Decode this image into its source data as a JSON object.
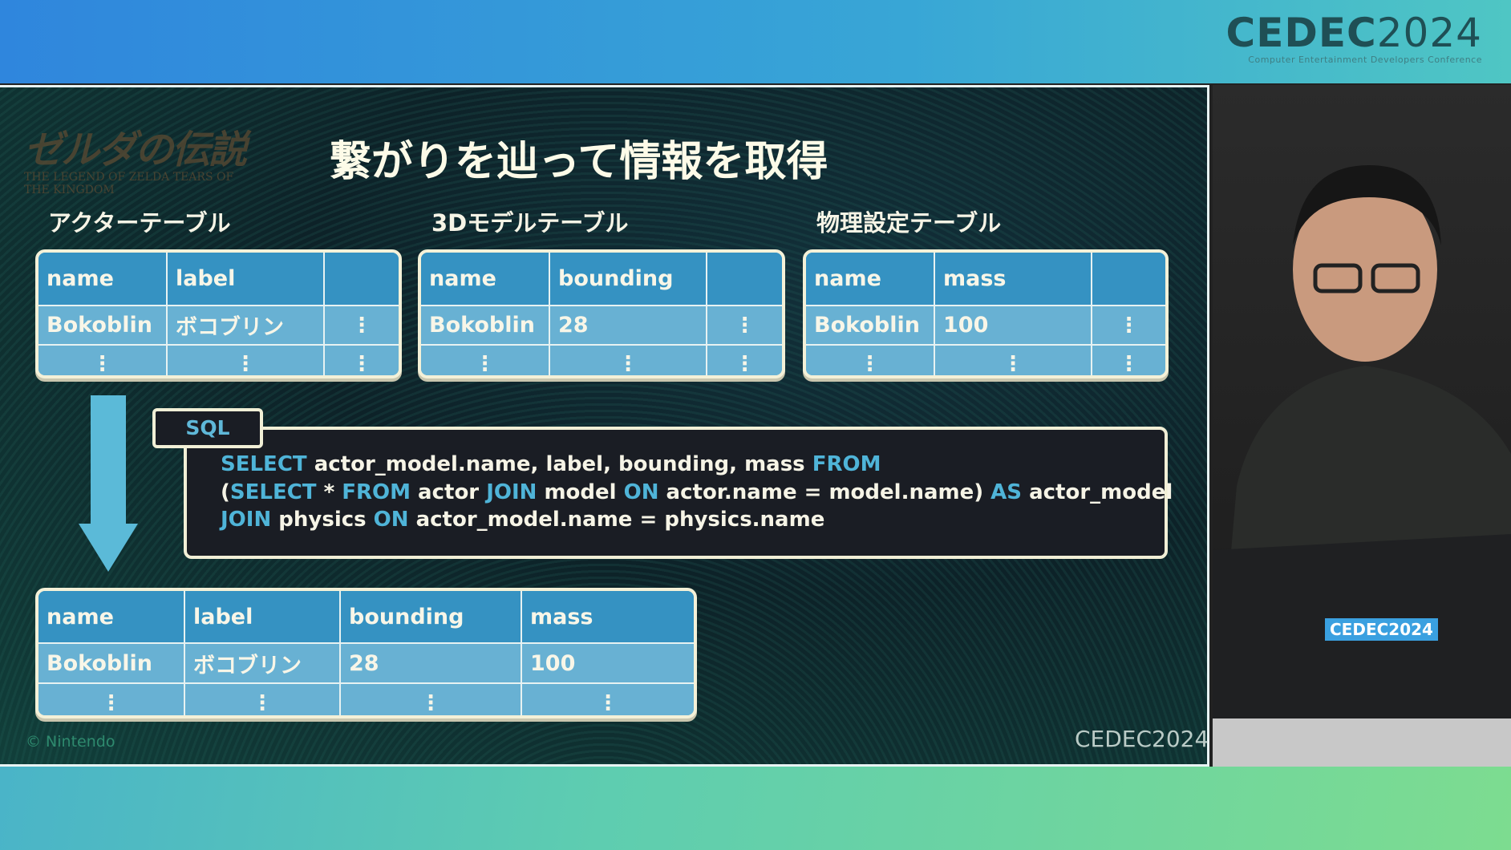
{
  "header": {
    "brand": "CEDEC",
    "year": "2024",
    "subtitle": "Computer Entertainment Developers Conference"
  },
  "slide": {
    "logo": {
      "title_jp": "ゼルダの伝説",
      "title_en": "THE LEGEND OF ZELDA TEARS OF THE KINGDOM"
    },
    "title": "繋がりを辿って情報を取得",
    "tables": [
      {
        "label": "アクターテーブル",
        "headers": [
          "name",
          "label",
          ""
        ],
        "rows": [
          [
            "Bokoblin",
            "ボコブリン",
            "⋮"
          ],
          [
            "⋮",
            "⋮",
            "⋮"
          ]
        ]
      },
      {
        "label": "3Dモデルテーブル",
        "headers": [
          "name",
          "bounding",
          ""
        ],
        "rows": [
          [
            "Bokoblin",
            "28",
            "⋮"
          ],
          [
            "⋮",
            "⋮",
            "⋮"
          ]
        ]
      },
      {
        "label": "物理設定テーブル",
        "headers": [
          "name",
          "mass",
          ""
        ],
        "rows": [
          [
            "Bokoblin",
            "100",
            "⋮"
          ],
          [
            "⋮",
            "⋮",
            "⋮"
          ]
        ]
      }
    ],
    "sql": {
      "tab": "SQL",
      "lines": [
        [
          {
            "k": true,
            "t": "SELECT"
          },
          {
            "k": false,
            "t": " actor_model.name, label, bounding, mass "
          },
          {
            "k": true,
            "t": "FROM"
          }
        ],
        [
          {
            "k": false,
            "t": "("
          },
          {
            "k": true,
            "t": "SELECT"
          },
          {
            "k": false,
            "t": " * "
          },
          {
            "k": true,
            "t": "FROM"
          },
          {
            "k": false,
            "t": " actor "
          },
          {
            "k": true,
            "t": "JOIN"
          },
          {
            "k": false,
            "t": " model "
          },
          {
            "k": true,
            "t": "ON"
          },
          {
            "k": false,
            "t": " actor.name = model.name) "
          },
          {
            "k": true,
            "t": "AS"
          },
          {
            "k": false,
            "t": " actor_model"
          }
        ],
        [
          {
            "k": true,
            "t": "JOIN"
          },
          {
            "k": false,
            "t": " physics "
          },
          {
            "k": true,
            "t": "ON"
          },
          {
            "k": false,
            "t": " actor_model.name = physics.name"
          }
        ]
      ]
    },
    "result": {
      "headers": [
        "name",
        "label",
        "bounding",
        "mass"
      ],
      "rows": [
        [
          "Bokoblin",
          "ボコブリン",
          "28",
          "100"
        ],
        [
          "⋮",
          "⋮",
          "⋮",
          "⋮"
        ]
      ]
    },
    "copyright": "© Nintendo",
    "footer_brand": "CEDEC",
    "footer_year": "2024"
  },
  "camera": {
    "laptop_sticker_brand": "CEDEC",
    "laptop_sticker_year": "2024"
  },
  "colors": {
    "header_cell": "#3592c2",
    "body_cell": "#68b1d3",
    "keyword": "#4fb4d8",
    "arrow": "#5bbad8"
  }
}
